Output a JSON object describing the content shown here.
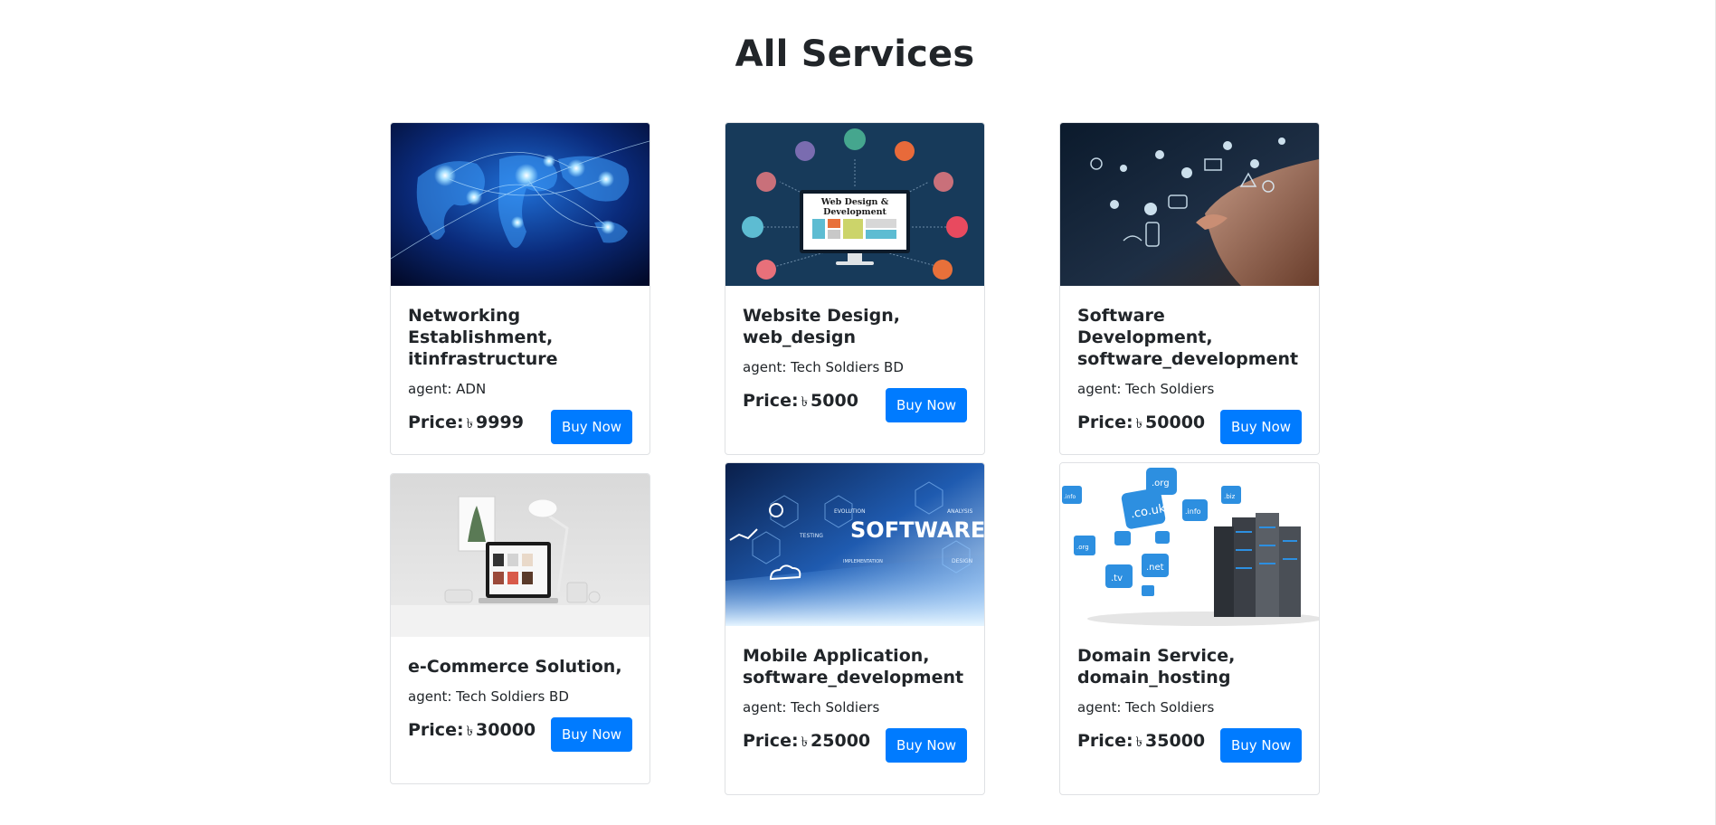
{
  "page": {
    "title": "All Services"
  },
  "services": [
    {
      "title": "Networking Establishment, itinfrastructure",
      "agent": "agent: ADN",
      "price_label": "Price:",
      "currency": "৳",
      "price": "9999",
      "button": "Buy Now",
      "image": "world-network-image"
    },
    {
      "title": "Website Design, web_design",
      "agent": "agent: Tech Soldiers BD",
      "price_label": "Price:",
      "currency": "৳",
      "price": "5000",
      "button": "Buy Now",
      "image": "web-design-development-image",
      "image_text": "Web Design & Development"
    },
    {
      "title": "Software Development, software_development",
      "agent": "agent: Tech Soldiers",
      "price_label": "Price:",
      "currency": "৳",
      "price": "50000",
      "button": "Buy Now",
      "image": "hand-touch-icons-image"
    },
    {
      "title": "e-Commerce Solution,",
      "agent": "agent: Tech Soldiers BD",
      "price_label": "Price:",
      "currency": "৳",
      "price": "30000",
      "button": "Buy Now",
      "image": "laptop-desk-image"
    },
    {
      "title": "Mobile Application, software_development",
      "agent": "agent: Tech Soldiers",
      "price_label": "Price:",
      "currency": "৳",
      "price": "25000",
      "button": "Buy Now",
      "image": "software-banner-image",
      "image_text": "SOFTWARE",
      "image_small_texts": [
        "EVOLUTION",
        "ANALYSIS",
        "TESTING",
        "IMPLEMENTATION",
        "DESIGN"
      ]
    },
    {
      "title": "Domain Service, domain_hosting",
      "agent": "agent: Tech Soldiers",
      "price_label": "Price:",
      "currency": "৳",
      "price": "35000",
      "button": "Buy Now",
      "image": "domain-hosting-servers-image",
      "image_small_texts": [
        ".co.uk",
        ".org",
        ".info",
        ".net",
        ".tv",
        ".biz",
        ".org",
        ".info"
      ]
    }
  ],
  "colors": {
    "primary": "#007bff",
    "text": "#212529",
    "card_border": "#dfe1e4"
  }
}
